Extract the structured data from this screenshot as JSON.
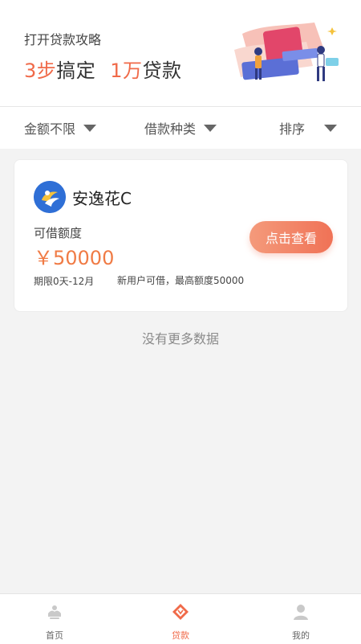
{
  "banner": {
    "subtitle": "打开贷款攻略",
    "steps_num": "3步",
    "steps_text": "搞定",
    "amount_num": "1万",
    "amount_text": "贷款"
  },
  "filters": [
    {
      "label": "金额不限"
    },
    {
      "label": "借款种类"
    },
    {
      "label": "排序"
    }
  ],
  "product": {
    "name": "安逸花C",
    "limit_label": "可借额度",
    "amount": "￥50000",
    "term": "期限0天-12月",
    "description": "新用户可借，最高额度50000",
    "cta_label": "点击查看"
  },
  "list_footer": "没有更多数据",
  "tabbar": [
    {
      "label": "首页",
      "icon": "home-icon"
    },
    {
      "label": "贷款",
      "icon": "loan-icon"
    },
    {
      "label": "我的",
      "icon": "profile-icon"
    }
  ],
  "colors": {
    "accent": "#f06a49",
    "amount": "#f07b45",
    "logo": "#2f6fd6"
  }
}
